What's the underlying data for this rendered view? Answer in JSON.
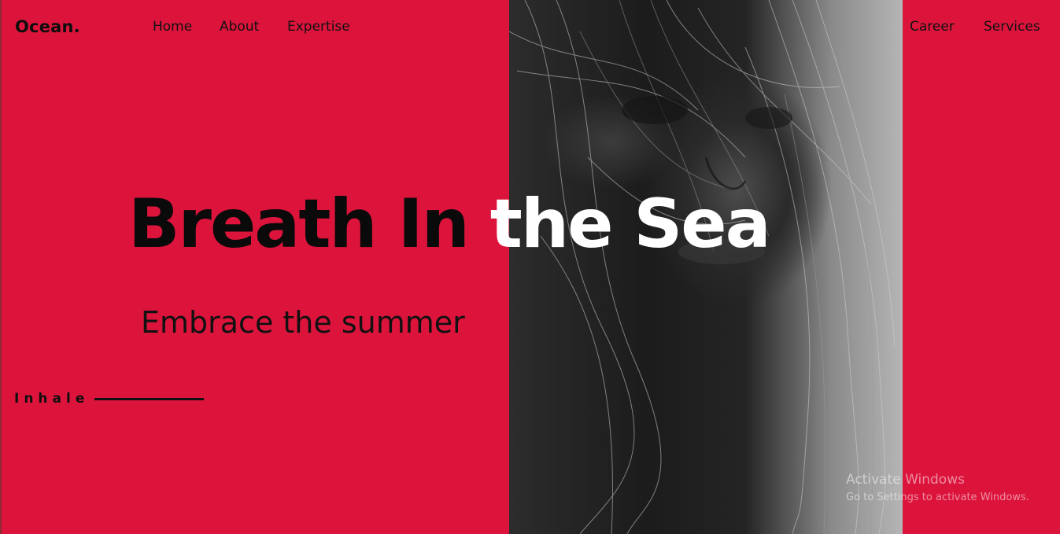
{
  "brand": {
    "logo": "Ocean."
  },
  "nav": {
    "home": "Home",
    "about": "About",
    "expertise": "Expertise",
    "career": "Career",
    "services": "Services"
  },
  "hero": {
    "title_part1": "Breath In ",
    "title_part2": "the Sea",
    "subtitle": "Embrace the summer",
    "cta": "Inhale"
  },
  "photo": {
    "alt": "portrait-photo"
  },
  "windows_watermark": {
    "title": "Activate Windows",
    "subtitle": "Go to Settings to activate Windows."
  },
  "colors": {
    "background": "#dc143c",
    "text_dark": "#0a0a0a",
    "text_light": "#ffffff"
  }
}
